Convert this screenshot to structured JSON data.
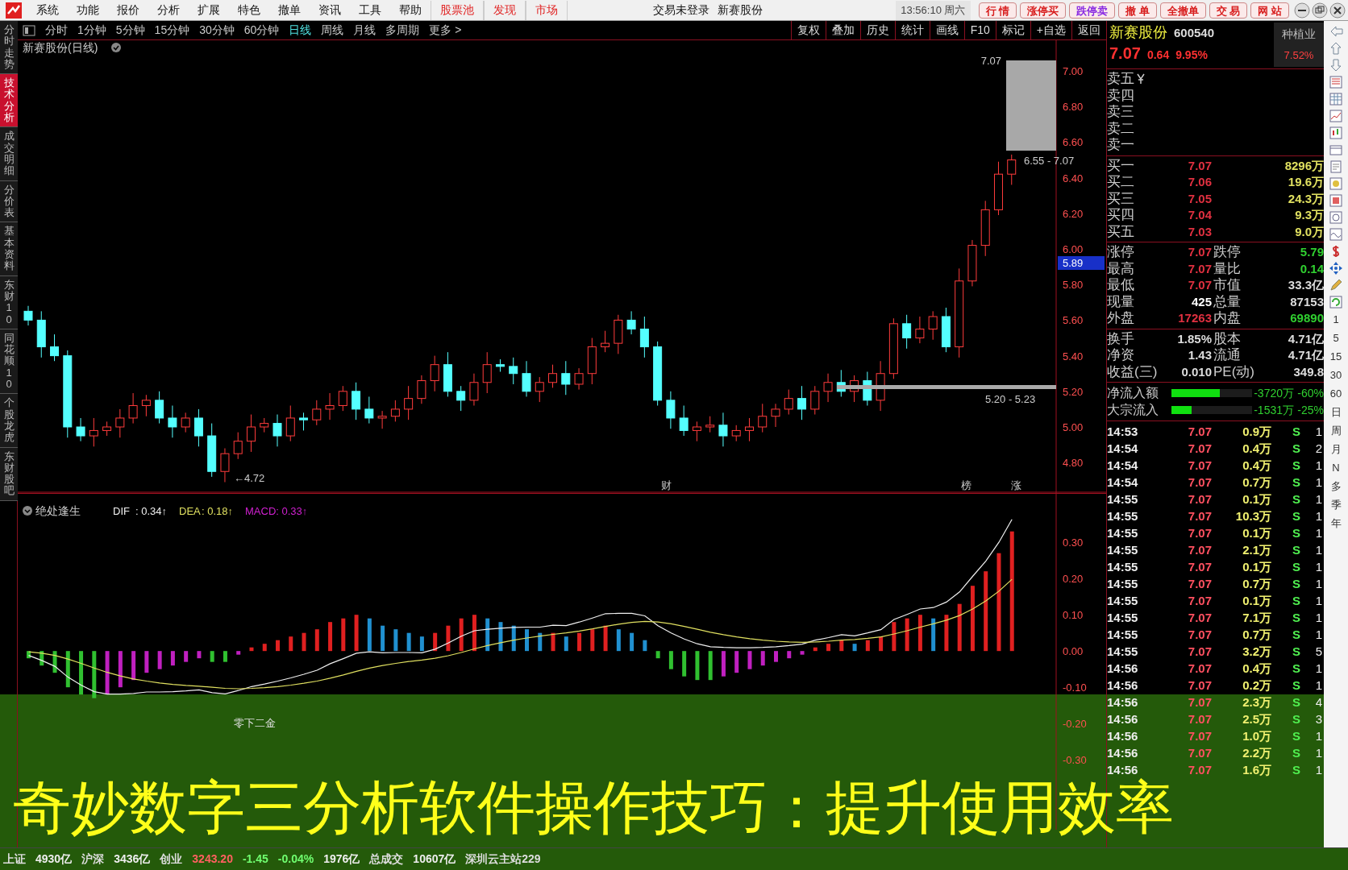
{
  "menu": [
    {
      "label": "系统",
      "highlighted": false
    },
    {
      "label": "功能",
      "highlighted": false
    },
    {
      "label": "报价",
      "highlighted": false
    },
    {
      "label": "分析",
      "highlighted": false
    },
    {
      "label": "扩展",
      "highlighted": false
    },
    {
      "label": "特色",
      "highlighted": false
    },
    {
      "label": "撤单",
      "highlighted": false
    },
    {
      "label": "资讯",
      "highlighted": false
    },
    {
      "label": "工具",
      "highlighted": false
    },
    {
      "label": "帮助",
      "highlighted": false
    },
    {
      "label": "股票池",
      "highlighted": true
    },
    {
      "label": "发现",
      "highlighted": true
    },
    {
      "label": "市场",
      "highlighted": true
    }
  ],
  "title_texts": [
    "交易未登录",
    "新赛股份"
  ],
  "clock": "13:56:10 周六",
  "trade_buttons": [
    {
      "label": "行 情",
      "color": "#d81e1e"
    },
    {
      "label": "涨停买",
      "color": "#d81e1e"
    },
    {
      "label": "跌停卖",
      "color": "#8a2be2"
    },
    {
      "label": "撤 单",
      "color": "#d81e1e"
    },
    {
      "label": "全撤单",
      "color": "#d81e1e"
    },
    {
      "label": "交 易",
      "color": "#d81e1e"
    },
    {
      "label": "网 站",
      "color": "#d81e1e"
    }
  ],
  "side_tabs": [
    {
      "label": "分时走势",
      "selected": false
    },
    {
      "label": "技术分析",
      "selected": true
    },
    {
      "label": "成交明细",
      "selected": false
    },
    {
      "label": "分价表",
      "selected": false
    },
    {
      "label": "基本资料",
      "selected": false
    },
    {
      "label": "东财10",
      "selected": false
    },
    {
      "label": "同花顺10",
      "selected": false
    },
    {
      "label": "个股龙虎",
      "selected": false
    },
    {
      "label": "东财股吧",
      "selected": false
    }
  ],
  "periods": [
    {
      "label": "分时",
      "selected": false
    },
    {
      "label": "1分钟",
      "selected": false
    },
    {
      "label": "5分钟",
      "selected": false
    },
    {
      "label": "15分钟",
      "selected": false
    },
    {
      "label": "30分钟",
      "selected": false
    },
    {
      "label": "60分钟",
      "selected": false
    },
    {
      "label": "日线",
      "selected": true
    },
    {
      "label": "周线",
      "selected": false
    },
    {
      "label": "月线",
      "selected": false
    },
    {
      "label": "多周期",
      "selected": false
    },
    {
      "label": "更多 >",
      "selected": false
    }
  ],
  "chart_tools": [
    "复权",
    "叠加",
    "历史",
    "统计",
    "画线",
    "F10",
    "标记",
    "+自选",
    "返回"
  ],
  "price_chart": {
    "title": "新赛股份(日线)",
    "chart_data": {
      "type": "candlestick",
      "ylim": [
        4.629,
        7.172
      ],
      "categories": [
        null,
        null,
        null,
        null,
        null,
        null,
        null,
        null,
        null,
        null,
        null,
        null,
        null,
        null,
        null,
        null,
        null,
        null,
        null,
        null,
        null,
        null,
        null,
        null,
        null,
        null,
        null,
        null,
        null,
        null,
        null,
        null,
        null,
        null,
        null,
        null,
        null,
        null,
        null,
        null,
        null,
        null,
        null,
        null,
        null,
        null,
        null,
        null,
        null,
        null,
        null,
        null,
        null,
        null,
        null,
        null,
        null,
        null,
        null,
        null,
        null,
        null,
        null,
        null,
        null,
        null,
        null,
        null,
        null,
        null,
        null,
        null,
        null,
        null,
        null,
        null
      ],
      "yticks": [
        {
          "value": 7.0,
          "label": "7.00"
        },
        {
          "value": 6.8,
          "label": "6.80"
        },
        {
          "value": 6.6,
          "label": "6.60"
        },
        {
          "value": 6.4,
          "label": "6.40"
        },
        {
          "value": 6.2,
          "label": "6.20"
        },
        {
          "value": 6.0,
          "label": "6.00"
        },
        {
          "value": 5.8,
          "label": "5.80"
        },
        {
          "value": 5.6,
          "label": "5.60"
        },
        {
          "value": 5.4,
          "label": "5.40"
        },
        {
          "value": 5.2,
          "label": "5.20"
        },
        {
          "value": 5.0,
          "label": "5.00"
        },
        {
          "value": 4.8,
          "label": "4.80"
        }
      ],
      "ohlc": [
        [
          5.65,
          5.68,
          5.57,
          5.6
        ],
        [
          5.6,
          5.65,
          5.39,
          5.45
        ],
        [
          5.45,
          5.52,
          5.37,
          5.4
        ],
        [
          5.4,
          5.43,
          4.94,
          5.0
        ],
        [
          5.0,
          5.05,
          4.92,
          4.95
        ],
        [
          4.95,
          5.05,
          4.89,
          4.98
        ],
        [
          4.98,
          5.03,
          4.95,
          5.0
        ],
        [
          5.0,
          5.1,
          4.94,
          5.05
        ],
        [
          5.05,
          5.19,
          5.02,
          5.12
        ],
        [
          5.12,
          5.18,
          5.06,
          5.15
        ],
        [
          5.15,
          5.2,
          5.02,
          5.05
        ],
        [
          5.05,
          5.12,
          4.94,
          5.0
        ],
        [
          5.0,
          5.08,
          4.97,
          5.05
        ],
        [
          5.05,
          5.1,
          4.89,
          4.95
        ],
        [
          4.95,
          5.02,
          4.72,
          4.75
        ],
        [
          4.75,
          4.88,
          4.69,
          4.85
        ],
        [
          4.85,
          4.97,
          4.82,
          4.92
        ],
        [
          4.92,
          5.07,
          4.86,
          5.0
        ],
        [
          5.0,
          5.05,
          4.97,
          5.02
        ],
        [
          5.02,
          5.07,
          4.89,
          4.95
        ],
        [
          4.95,
          5.12,
          4.92,
          5.05
        ],
        [
          5.05,
          5.08,
          4.98,
          5.04
        ],
        [
          5.04,
          5.15,
          5.01,
          5.1
        ],
        [
          5.1,
          5.19,
          5.04,
          5.12
        ],
        [
          5.12,
          5.23,
          5.09,
          5.2
        ],
        [
          5.2,
          5.25,
          5.04,
          5.1
        ],
        [
          5.1,
          5.17,
          5.02,
          5.05
        ],
        [
          5.05,
          5.09,
          4.99,
          5.06
        ],
        [
          5.06,
          5.15,
          5.03,
          5.1
        ],
        [
          5.1,
          5.23,
          5.04,
          5.16
        ],
        [
          5.16,
          5.29,
          5.13,
          5.26
        ],
        [
          5.26,
          5.4,
          5.2,
          5.35
        ],
        [
          5.35,
          5.42,
          5.17,
          5.2
        ],
        [
          5.2,
          5.23,
          5.09,
          5.15
        ],
        [
          5.15,
          5.3,
          5.12,
          5.25
        ],
        [
          5.25,
          5.42,
          5.19,
          5.35
        ],
        [
          5.35,
          5.38,
          5.31,
          5.34
        ],
        [
          5.34,
          5.39,
          5.24,
          5.3
        ],
        [
          5.3,
          5.37,
          5.17,
          5.2
        ],
        [
          5.2,
          5.28,
          5.14,
          5.25
        ],
        [
          5.25,
          5.35,
          5.22,
          5.3
        ],
        [
          5.3,
          5.37,
          5.18,
          5.24
        ],
        [
          5.24,
          5.33,
          5.21,
          5.3
        ],
        [
          5.3,
          5.5,
          5.24,
          5.45
        ],
        [
          5.45,
          5.54,
          5.42,
          5.47
        ],
        [
          5.47,
          5.63,
          5.41,
          5.6
        ],
        [
          5.6,
          5.65,
          5.52,
          5.55
        ],
        [
          5.55,
          5.62,
          5.39,
          5.45
        ],
        [
          5.45,
          5.48,
          5.12,
          5.15
        ],
        [
          5.15,
          5.2,
          4.99,
          5.05
        ],
        [
          5.05,
          5.12,
          4.95,
          4.98
        ],
        [
          4.98,
          5.03,
          4.92,
          5.0
        ],
        [
          5.0,
          5.06,
          4.97,
          5.01
        ],
        [
          5.01,
          5.08,
          4.89,
          4.95
        ],
        [
          4.95,
          5.01,
          4.92,
          4.98
        ],
        [
          4.98,
          5.05,
          4.92,
          5.0
        ],
        [
          5.0,
          5.13,
          4.97,
          5.06
        ],
        [
          5.06,
          5.13,
          5.0,
          5.1
        ],
        [
          5.1,
          5.21,
          5.07,
          5.16
        ],
        [
          5.16,
          5.23,
          5.04,
          5.1
        ],
        [
          5.1,
          5.23,
          5.07,
          5.2
        ],
        [
          5.2,
          5.3,
          5.14,
          5.25
        ],
        [
          5.25,
          5.32,
          5.17,
          5.2
        ],
        [
          5.2,
          5.29,
          5.14,
          5.26
        ],
        [
          5.26,
          5.31,
          5.12,
          5.15
        ],
        [
          5.15,
          5.37,
          5.09,
          5.3
        ],
        [
          5.3,
          5.61,
          5.27,
          5.58
        ],
        [
          5.58,
          5.63,
          5.44,
          5.5
        ],
        [
          5.5,
          5.62,
          5.47,
          5.55
        ],
        [
          5.55,
          5.65,
          5.49,
          5.62
        ],
        [
          5.62,
          5.67,
          5.42,
          5.45
        ],
        [
          5.45,
          5.89,
          5.39,
          5.82
        ],
        [
          5.82,
          6.05,
          5.79,
          6.02
        ],
        [
          6.02,
          6.27,
          5.96,
          6.22
        ],
        [
          6.22,
          6.49,
          6.19,
          6.42
        ],
        [
          6.42,
          6.53,
          6.36,
          6.5
        ]
      ]
    },
    "current_price": "5.89",
    "high_label": "7.07",
    "range_top": "6.55 - 7.07",
    "range_bottom": "5.20 - 5.23",
    "low_label": "←4.72",
    "markers": [
      "财",
      "榜",
      "涨"
    ]
  },
  "macd": {
    "name": "绝处逢生",
    "readings": [
      ": 0.34↑",
      ": 0.18↑"
    ],
    "macd": "MACD: 0.33↑",
    "annotation": "零下二金",
    "chart_data": {
      "type": "line",
      "ylim": [
        -0.493,
        0.436
      ],
      "categories": [
        null,
        null,
        null,
        null,
        null,
        null,
        null,
        null,
        null,
        null,
        null,
        null,
        null,
        null,
        null,
        null,
        null,
        null,
        null,
        null,
        null,
        null,
        null,
        null,
        null,
        null,
        null,
        null,
        null,
        null,
        null,
        null,
        null,
        null,
        null,
        null,
        null,
        null,
        null,
        null,
        null,
        null,
        null,
        null,
        null,
        null,
        null,
        null,
        null,
        null,
        null,
        null,
        null,
        null,
        null,
        null,
        null,
        null,
        null,
        null,
        null,
        null,
        null,
        null,
        null,
        null,
        null,
        null,
        null,
        null,
        null,
        null,
        null,
        null,
        null,
        null
      ],
      "yticks": [
        {
          "value": 0.3,
          "label": "0.30"
        },
        {
          "value": 0.2,
          "label": "0.20"
        },
        {
          "value": 0.1,
          "label": "0.10"
        },
        {
          "value": 0,
          "label": "0.00"
        },
        {
          "value": -0.1,
          "label": "-0.10"
        },
        {
          "value": -0.2,
          "label": "-0.20"
        },
        {
          "value": -0.3,
          "label": "-0.30"
        }
      ],
      "series": [
        {
          "name": "DIF",
          "color": "#f0f0f0",
          "values": [
            -0.012,
            -0.026,
            -0.042,
            -0.072,
            -0.094,
            -0.112,
            -0.119,
            -0.119,
            -0.117,
            -0.113,
            -0.113,
            -0.112,
            -0.11,
            -0.107,
            -0.115,
            -0.118,
            -0.109,
            -0.098,
            -0.091,
            -0.083,
            -0.074,
            -0.064,
            -0.053,
            -0.035,
            -0.021,
            -0.006,
            -0.002,
            -0.005,
            -0.004,
            -0.004,
            -0.005,
            0.005,
            0.022,
            0.041,
            0.056,
            0.06,
            0.063,
            0.065,
            0.066,
            0.066,
            0.071,
            0.07,
            0.08,
            0.091,
            0.103,
            0.104,
            0.104,
            0.097,
            0.07,
            0.05,
            0.033,
            0.02,
            0.012,
            0.01,
            0.009,
            0.009,
            0.01,
            0.012,
            0.015,
            0.019,
            0.03,
            0.037,
            0.045,
            0.042,
            0.05,
            0.059,
            0.087,
            0.101,
            0.116,
            0.12,
            0.135,
            0.163,
            0.206,
            0.248,
            0.3,
            0.363
          ]
        },
        {
          "name": "DEA",
          "color": "#e0e060",
          "values": [
            -0.002,
            -0.006,
            -0.012,
            -0.022,
            -0.034,
            -0.047,
            -0.059,
            -0.069,
            -0.077,
            -0.083,
            -0.088,
            -0.092,
            -0.095,
            -0.097,
            -0.1,
            -0.103,
            -0.104,
            -0.103,
            -0.101,
            -0.098,
            -0.094,
            -0.089,
            -0.083,
            -0.075,
            -0.066,
            -0.056,
            -0.047,
            -0.04,
            -0.034,
            -0.029,
            -0.025,
            -0.02,
            -0.013,
            -0.004,
            0.006,
            0.015,
            0.023,
            0.03,
            0.036,
            0.041,
            0.046,
            0.05,
            0.055,
            0.061,
            0.068,
            0.074,
            0.079,
            0.082,
            0.08,
            0.075,
            0.068,
            0.06,
            0.052,
            0.045,
            0.039,
            0.034,
            0.03,
            0.027,
            0.025,
            0.024,
            0.025,
            0.027,
            0.03,
            0.032,
            0.035,
            0.039,
            0.047,
            0.056,
            0.066,
            0.075,
            0.085,
            0.098,
            0.116,
            0.138,
            0.165,
            0.198
          ]
        }
      ]
    }
  },
  "quote": {
    "name": "新赛股份",
    "code": "600540",
    "industry": "种植业",
    "industry_change": "7.52%",
    "price": "7.07",
    "change": "0.64",
    "change_pct": "9.95%",
    "asks": [
      "卖五",
      "卖四",
      "卖三",
      "卖二",
      "卖一"
    ],
    "bids": [
      {
        "label": "买一",
        "price": "7.07",
        "volume": "8296万"
      },
      {
        "label": "买二",
        "price": "7.06",
        "volume": "19.6万"
      },
      {
        "label": "买三",
        "price": "7.05",
        "volume": "24.3万"
      },
      {
        "label": "买四",
        "price": "7.04",
        "volume": "9.3万"
      },
      {
        "label": "买五",
        "price": "7.03",
        "volume": "9.0万"
      }
    ],
    "stats": [
      {
        "l1": "涨停",
        "v1": "7.07",
        "l2": "跌停",
        "v2": "5.79"
      },
      {
        "l1": "最高",
        "v1": "7.07",
        "l2": "量比",
        "v2": "0.14"
      },
      {
        "l1": "最低",
        "v1": "7.07",
        "l2": "市值",
        "v2": "33.3亿"
      },
      {
        "l1": "现量",
        "v1": "425",
        "l2": "总量",
        "v2": "87153"
      },
      {
        "l1": "外盘",
        "v1": "17263",
        "l2": "内盘",
        "v2": "69890"
      }
    ],
    "stats2": [
      {
        "l1": "换手",
        "v1": "1.85%",
        "l2": "股本",
        "v2": "4.71亿"
      },
      {
        "l1": "净资",
        "v1": "1.43",
        "l2": "流通",
        "v2": "4.71亿"
      },
      {
        "l1": "收益(三)",
        "v1": "0.010",
        "l2": "PE(动)",
        "v2": "349.8"
      }
    ],
    "flows": [
      {
        "label": "净流入额",
        "level": 0.6,
        "amount": "-3720万",
        "pct": "-60%"
      },
      {
        "label": "大宗流入",
        "level": 0.25,
        "amount": "-1531万",
        "pct": "-25%"
      }
    ]
  },
  "ticks": [
    {
      "time": "14:53",
      "price": "7.07",
      "volume": "0.9万",
      "side": "S",
      "count": "1"
    },
    {
      "time": "14:54",
      "price": "7.07",
      "volume": "0.4万",
      "side": "S",
      "count": "2"
    },
    {
      "time": "14:54",
      "price": "7.07",
      "volume": "0.4万",
      "side": "S",
      "count": "1"
    },
    {
      "time": "14:54",
      "price": "7.07",
      "volume": "0.7万",
      "side": "S",
      "count": "1"
    },
    {
      "time": "14:55",
      "price": "7.07",
      "volume": "0.1万",
      "side": "S",
      "count": "1"
    },
    {
      "time": "14:55",
      "price": "7.07",
      "volume": "10.3万",
      "side": "S",
      "count": "1"
    },
    {
      "time": "14:55",
      "price": "7.07",
      "volume": "0.1万",
      "side": "S",
      "count": "1"
    },
    {
      "time": "14:55",
      "price": "7.07",
      "volume": "2.1万",
      "side": "S",
      "count": "1"
    },
    {
      "time": "14:55",
      "price": "7.07",
      "volume": "0.1万",
      "side": "S",
      "count": "1"
    },
    {
      "time": "14:55",
      "price": "7.07",
      "volume": "0.7万",
      "side": "S",
      "count": "1"
    },
    {
      "time": "14:55",
      "price": "7.07",
      "volume": "0.1万",
      "side": "S",
      "count": "1"
    },
    {
      "time": "14:55",
      "price": "7.07",
      "volume": "7.1万",
      "side": "S",
      "count": "1"
    },
    {
      "time": "14:55",
      "price": "7.07",
      "volume": "0.7万",
      "side": "S",
      "count": "1"
    },
    {
      "time": "14:55",
      "price": "7.07",
      "volume": "3.2万",
      "side": "S",
      "count": "5"
    },
    {
      "time": "14:56",
      "price": "7.07",
      "volume": "0.4万",
      "side": "S",
      "count": "1"
    },
    {
      "time": "14:56",
      "price": "7.07",
      "volume": "0.2万",
      "side": "S",
      "count": "1"
    },
    {
      "time": "14:56",
      "price": "7.07",
      "volume": "2.3万",
      "side": "S",
      "count": "4"
    },
    {
      "time": "14:56",
      "price": "7.07",
      "volume": "2.5万",
      "side": "S",
      "count": "3"
    },
    {
      "time": "14:56",
      "price": "7.07",
      "volume": "1.0万",
      "side": "S",
      "count": "1"
    },
    {
      "time": "14:56",
      "price": "7.07",
      "volume": "2.2万",
      "side": "S",
      "count": "1"
    },
    {
      "time": "14:56",
      "price": "7.07",
      "volume": "1.6万",
      "side": "S",
      "count": "1"
    }
  ],
  "period_buttons": [
    "1",
    "5",
    "15",
    "30",
    "60",
    "日",
    "周",
    "月",
    "N",
    "多",
    "季",
    "年"
  ],
  "status_bar": [
    {
      "text": "上证",
      "kind": "label"
    },
    {
      "text": "4930亿",
      "kind": "value"
    },
    {
      "text": "沪深",
      "kind": "label"
    },
    {
      "text": "3436亿",
      "kind": "value"
    },
    {
      "text": "创业",
      "kind": "label"
    },
    {
      "text": "3243.20",
      "kind": "up"
    },
    {
      "text": "-1.45",
      "kind": "down"
    },
    {
      "text": "-0.04%",
      "kind": "down"
    },
    {
      "text": "1976亿",
      "kind": "value"
    },
    {
      "text": "总成交",
      "kind": "label"
    },
    {
      "text": "10607亿",
      "kind": "value"
    },
    {
      "text": "深圳云主站229",
      "kind": "label"
    }
  ],
  "caption": "奇妙数字三分析软件操作技巧：提升使用效率"
}
